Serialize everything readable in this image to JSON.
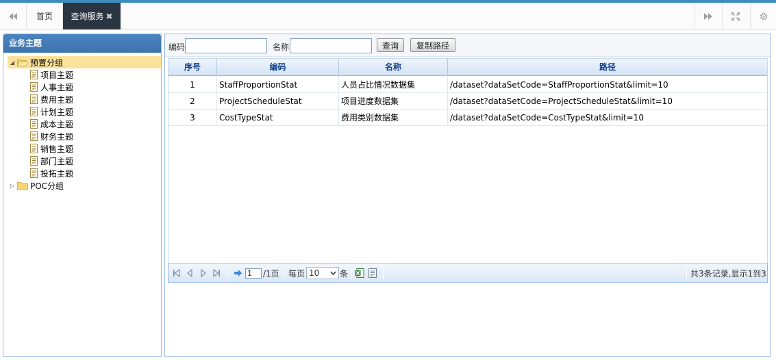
{
  "tabbar": {
    "tabs": [
      {
        "label": "首页"
      },
      {
        "label": "查询服务",
        "close": "✖"
      }
    ]
  },
  "left": {
    "title": "业务主题",
    "tree": {
      "group1": "预置分组",
      "items": [
        "项目主题",
        "人事主题",
        "费用主题",
        "计划主题",
        "成本主题",
        "财务主题",
        "销售主题",
        "部门主题",
        "投拓主题"
      ],
      "group2": "POC分组"
    }
  },
  "toolbar": {
    "code_label": "编码",
    "code_value": "",
    "name_label": "名称",
    "name_value": "",
    "query_button": "查询",
    "copy_button": "复制路径"
  },
  "table": {
    "headers": [
      "序号",
      "编码",
      "名称",
      "路径"
    ],
    "rows": [
      [
        "1",
        "StaffProportionStat",
        "人员占比情况数据集",
        "/dataset?dataSetCode=StaffProportionStat&limit=10"
      ],
      [
        "2",
        "ProjectScheduleStat",
        "项目进度数据集",
        "/dataset?dataSetCode=ProjectScheduleStat&limit=10"
      ],
      [
        "3",
        "CostTypeStat",
        "费用类别数据集",
        "/dataset?dataSetCode=CostTypeStat&limit=10"
      ]
    ]
  },
  "pager": {
    "page": "1",
    "total_pages": "/1页",
    "per_page_label": "每页",
    "per_page": "10",
    "unit": "条",
    "summary": "共3条记录,显示1到3"
  },
  "colors": {
    "accent": "#3c8dbc",
    "active_tab": "#2a3542",
    "panel_header": "#4a84bf",
    "selected_node": "#fbe29b",
    "grid_header_text": "#15428b"
  }
}
